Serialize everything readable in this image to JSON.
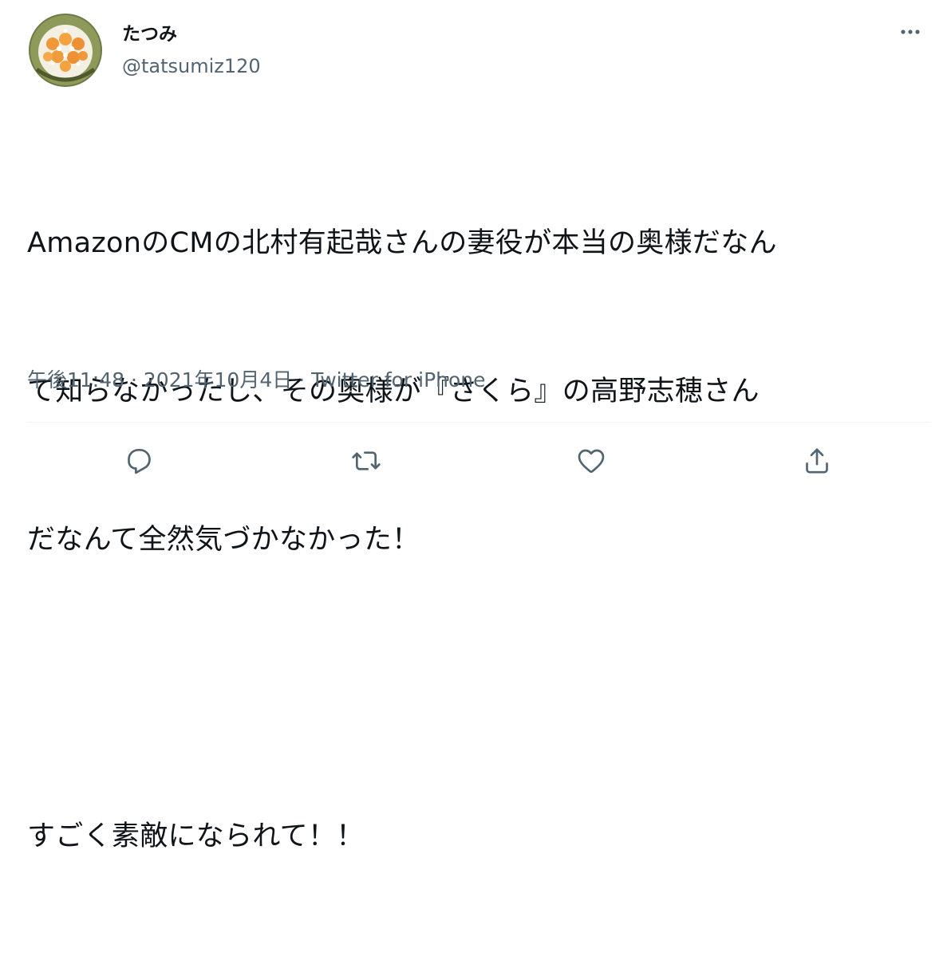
{
  "user": {
    "display_name": "たつみ",
    "handle": "@tatsumiz120",
    "avatar_icon": "food-photo-avatar"
  },
  "tweet": {
    "lines": [
      "AmazonのCMの北村有起哉さんの妻役が本当の奥様だなん",
      "て知らなかったし、その奥様が『さくら』の高野志穂さん",
      "だなんて全然気づかなかった！",
      "",
      "すごく素敵になられて！！"
    ]
  },
  "meta": {
    "time": "午後11:48",
    "separator": " · ",
    "date": "2021年10月4日",
    "source": "Twitter for iPhone"
  },
  "actions": {
    "reply_icon": "reply-icon",
    "retweet_icon": "retweet-icon",
    "like_icon": "heart-icon",
    "share_icon": "share-icon"
  },
  "colors": {
    "text": "#0f1419",
    "secondary": "#536471",
    "divider": "#eff3f4"
  }
}
